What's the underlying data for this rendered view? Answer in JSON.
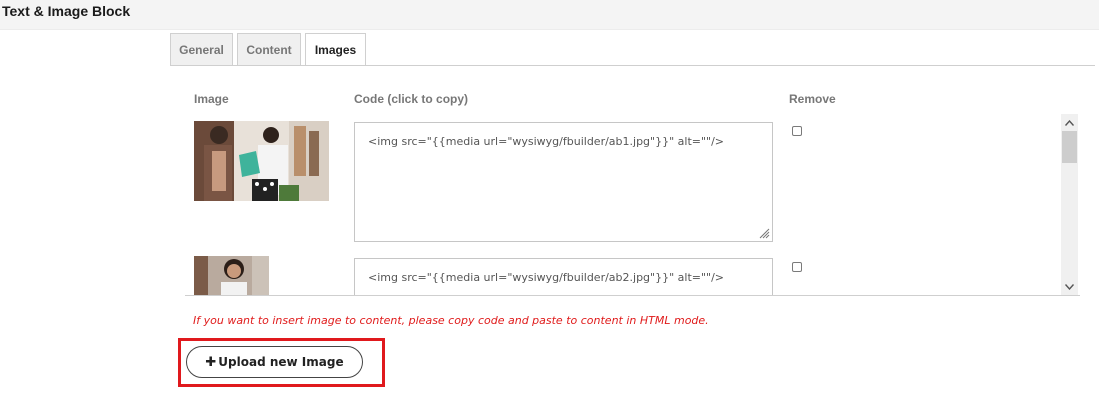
{
  "window": {
    "title": "Text & Image Block"
  },
  "tabs": [
    {
      "label": "General"
    },
    {
      "label": "Content"
    },
    {
      "label": "Images"
    }
  ],
  "active_tab": "Images",
  "table": {
    "headers": {
      "image": "Image",
      "code": "Code (click to copy)",
      "remove": "Remove"
    },
    "rows": [
      {
        "code": "<img src=\"{{media url=\"wysiwyg/fbuilder/ab1.jpg\"}}\" alt=\"\"/>",
        "remove_checked": false
      },
      {
        "code": "<img src=\"{{media url=\"wysiwyg/fbuilder/ab2.jpg\"}}\" alt=\"\"/>",
        "remove_checked": false
      }
    ]
  },
  "help_text": "If you want to insert image to content, please copy code and paste to content in HTML mode.",
  "upload_button": {
    "label": "Upload new Image",
    "icon": "plus-icon"
  },
  "colors": {
    "help_text": "#e01b1b",
    "highlight_border": "#e0191d"
  }
}
